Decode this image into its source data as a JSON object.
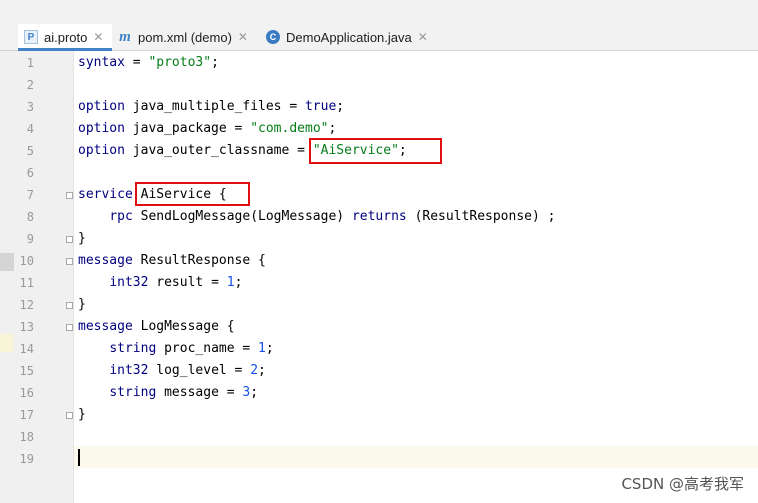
{
  "tabs": [
    {
      "label": "ai.proto",
      "icon": "proto-file-icon",
      "icon_glyph": "P",
      "active": true
    },
    {
      "label": "pom.xml (demo)",
      "icon": "maven-file-icon",
      "icon_glyph": "m",
      "active": false
    },
    {
      "label": "DemoApplication.java",
      "icon": "java-class-icon",
      "icon_glyph": "C",
      "active": false
    }
  ],
  "close_glyph": "✕",
  "line_numbers": [
    "1",
    "2",
    "3",
    "4",
    "5",
    "6",
    "7",
    "8",
    "9",
    "10",
    "11",
    "12",
    "13",
    "14",
    "15",
    "16",
    "17",
    "18",
    "19"
  ],
  "code": {
    "l1_a": "syntax",
    "l1_b": " = ",
    "l1_c": "\"proto3\"",
    "l1_d": ";",
    "l3_a": "option",
    "l3_b": " java_multiple_files = ",
    "l3_c": "true",
    "l3_d": ";",
    "l4_a": "option",
    "l4_b": " java_package = ",
    "l4_c": "\"com.demo\"",
    "l4_d": ";",
    "l5_a": "option",
    "l5_b": " java_outer_classname = ",
    "l5_c": "\"AiService\"",
    "l5_d": ";",
    "l7_a": "service",
    "l7_b": " AiService {",
    "l8_pad": "    ",
    "l8_a": "rpc",
    "l8_b": " SendLogMessage(LogMessage) ",
    "l8_c": "returns",
    "l8_d": " (ResultResponse) ;",
    "l9": "}",
    "l10_a": "message",
    "l10_b": " ResultResponse {",
    "l11_pad": "    ",
    "l11_a": "int32",
    "l11_b": " result = ",
    "l11_c": "1",
    "l11_d": ";",
    "l12": "}",
    "l13_a": "message",
    "l13_b": " LogMessage {",
    "l14_pad": "    ",
    "l14_a": "string",
    "l14_b": " proc_name = ",
    "l14_c": "1",
    "l14_d": ";",
    "l15_pad": "    ",
    "l15_a": "int32",
    "l15_b": " log_level = ",
    "l15_c": "2",
    "l15_d": ";",
    "l16_pad": "    ",
    "l16_a": "string",
    "l16_b": " message = ",
    "l16_c": "3",
    "l16_d": ";",
    "l17": "}"
  },
  "colors": {
    "keyword": "#000080",
    "string": "#067d17",
    "number": "#1750eb",
    "highlight_box": "#e01010",
    "tab_accent": "#4083c9"
  },
  "watermark": "CSDN @高考我军"
}
